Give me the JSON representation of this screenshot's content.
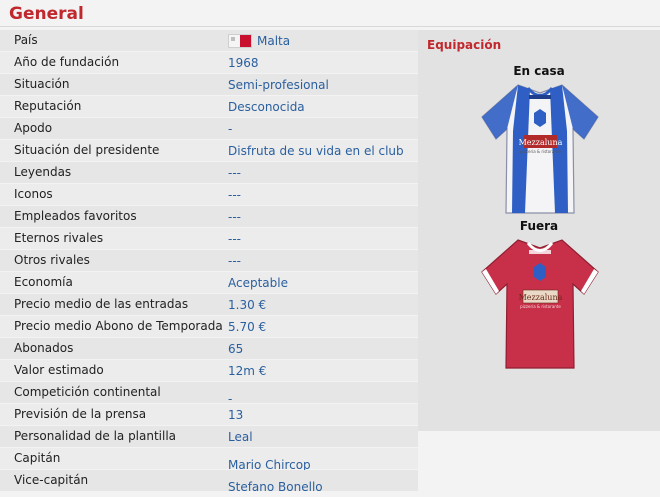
{
  "section_title": "General",
  "rows": [
    {
      "label": "País",
      "value": "Malta"
    },
    {
      "label": "Año de fundación",
      "value": "1968"
    },
    {
      "label": "Situación",
      "value": "Semi-profesional"
    },
    {
      "label": "Reputación",
      "value": "Desconocida"
    },
    {
      "label": "Apodo",
      "value": "-"
    },
    {
      "label": "Situación del presidente",
      "value": "Disfruta de su vida en el club"
    },
    {
      "label": "Leyendas",
      "value": "---"
    },
    {
      "label": "Iconos",
      "value": "---"
    },
    {
      "label": "Empleados favoritos",
      "value": "---"
    },
    {
      "label": "Eternos rivales",
      "value": "---"
    },
    {
      "label": "Otros rivales",
      "value": "---"
    },
    {
      "label": "Economía",
      "value": "Aceptable"
    },
    {
      "label": "Precio medio de las entradas",
      "value": "1.30 €"
    },
    {
      "label": "Precio medio Abono de Temporada",
      "value": "5.70 €"
    },
    {
      "label": "Abonados",
      "value": "65"
    },
    {
      "label": "Valor estimado",
      "value": "12m €"
    },
    {
      "label": "Competición continental",
      "value": "-"
    },
    {
      "label": "Previsión de la prensa",
      "value": "13"
    },
    {
      "label": "Personalidad de la plantilla",
      "value": "Leal"
    },
    {
      "label": "Capitán",
      "value": "Mario Chircop"
    },
    {
      "label": "Vice-capitán",
      "value": "Stefano Bonello"
    }
  ],
  "kits": {
    "title": "Equipación",
    "home_label": "En casa",
    "away_label": "Fuera",
    "brand": "DIADORA",
    "sponsor": "Mezzaluna",
    "sponsor_sub": "pizzeria & ristorante",
    "home_colors": {
      "body": "#f4f4f6",
      "stripe": "#2f5fc4"
    },
    "away_colors": {
      "body": "#c8304a",
      "trim": "#ffffff"
    }
  }
}
